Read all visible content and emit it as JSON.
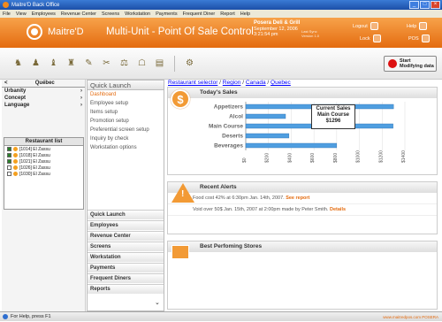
{
  "window": {
    "title": "Maitre'D Back Office"
  },
  "menu": [
    "File",
    "View",
    "Employees",
    "Revenue Center",
    "Screens",
    "Workstation",
    "Payments",
    "Frequent Diner",
    "Report",
    "Help"
  ],
  "header": {
    "logo_text": "Maitre'D",
    "app_title": "Multi-Unit - Point Of Sale Control",
    "store_name": "Posera Deli & Grill",
    "date": "September 12, 2006",
    "time": "3:21:54 pm",
    "version_label": "Last Sync",
    "version_value": "Version 1.0",
    "logout": "Logout",
    "lock": "Lock",
    "help": "Help",
    "pos": "POS"
  },
  "toolbar": {
    "start_label": "Start",
    "start_sub": "Modifying data"
  },
  "left_nav": {
    "back": "<",
    "region": "Québec",
    "items": [
      "Urbanity",
      "Concept",
      "Language"
    ],
    "restaurant_list_title": "Restaurant list",
    "restaurants": [
      {
        "label": "[1014] El Zassu",
        "checked": true
      },
      {
        "label": "[1018] El Zassu",
        "checked": true
      },
      {
        "label": "[1021] El Zassu",
        "checked": true
      },
      {
        "label": "[1026] El Zassu",
        "checked": false
      },
      {
        "label": "[1030] El Zassu",
        "checked": false
      }
    ]
  },
  "quick_launch": {
    "title": "Quick Launch",
    "items": [
      "Dashboard",
      "Employee setup",
      "Items setup",
      "Promotion setup",
      "Preferential screen setup",
      "Inquiry by check",
      "Workstation options"
    ],
    "accordion": [
      "Quick Launch",
      "Employees",
      "Revenue Center",
      "Screens",
      "Workstation",
      "Payments",
      "Frequent Diners",
      "Reports"
    ]
  },
  "breadcrumb": [
    "Restaurant selector",
    "Region",
    "Canada",
    "Quebec"
  ],
  "sales": {
    "title": "Today's Sales",
    "tooltip": [
      "Current Sales",
      "Main Course",
      "$1296"
    ]
  },
  "chart_data": {
    "type": "bar",
    "orientation": "horizontal",
    "categories": [
      "Appetizers",
      "Alcol",
      "Main Course",
      "Deserts",
      "Beverages"
    ],
    "values": [
      1300,
      350,
      1296,
      380,
      800
    ],
    "xticks": [
      "$0",
      "$200",
      "$400",
      "$600",
      "$800",
      "$1000",
      "$1200",
      "$1400"
    ],
    "xlim": [
      0,
      1400
    ],
    "colors": {
      "bar": "#4f9ee0"
    }
  },
  "alerts": {
    "title": "Recent Alerts",
    "lines": [
      {
        "text": "Food cost 42% at 6:30pm Jan. 14th, 2007.",
        "link": "See report"
      },
      {
        "text": "Void over 50$ Jan. 15th, 2007 at 2:00pm made by Peter Smith.",
        "link": "Details"
      }
    ]
  },
  "best": {
    "title": "Best Perfoming Stores"
  },
  "status": {
    "text": "For Help, press F1",
    "brand": "www.maitredpos.com POSERA"
  }
}
